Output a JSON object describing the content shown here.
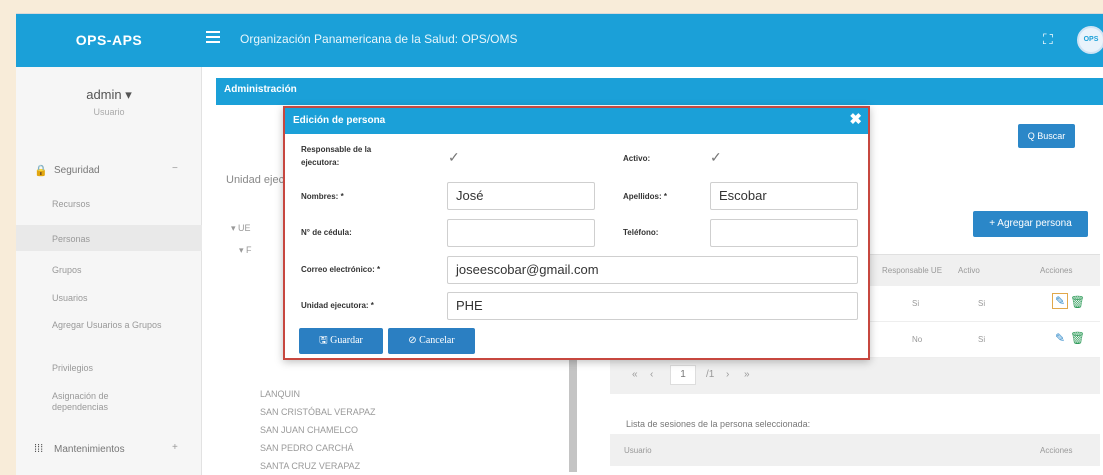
{
  "topbar": {
    "brand": "OPS-APS",
    "org_title": "Organización Panamericana de la Salud: OPS/OMS",
    "fullscreen_glyph": "⛶",
    "avatar_text": "OPS"
  },
  "sidebar": {
    "user_name": "admin ▾",
    "user_role": "Usuario",
    "seguridad": {
      "label": "Seguridad",
      "icon": "lock-icon",
      "glyph": "🔒",
      "toggle": "−"
    },
    "items": [
      {
        "label": "Recursos"
      },
      {
        "label": "Personas"
      },
      {
        "label": "Grupos"
      },
      {
        "label": "Usuarios"
      },
      {
        "label": "Agregar Usuarios a Grupos"
      },
      {
        "label": "Privilegios"
      },
      {
        "label": "Asignación de dependencias"
      }
    ],
    "mantenimientos": {
      "label": "Mantenimientos",
      "icon": "grid-icon",
      "glyph": "⁞⁞⁞",
      "toggle": "+"
    }
  },
  "main": {
    "panel_title": "Administración",
    "search_label": "Q Buscar",
    "unidad_label": "Unidad ejecutora:",
    "add_person_label": "+ Agregar persona",
    "tree_items": [
      "▾ UE",
      "▾ F",
      "LANQUIN",
      "SAN CRISTÓBAL VERAPAZ",
      "SAN JUAN CHAMELCO",
      "SAN PEDRO CARCHÁ",
      "SANTA CRUZ VERAPAZ"
    ],
    "grid_headers": {
      "responsable": "Responsable UE",
      "activo": "Activo",
      "acciones": "Acciones"
    },
    "grid_rows": [
      {
        "responsable": "Si",
        "activo": "Si",
        "edit_glyph": "✎",
        "delete_glyph": "🗑"
      },
      {
        "responsable": "No",
        "activo": "Si",
        "edit_glyph": "✎",
        "delete_glyph": "🗑"
      }
    ],
    "pager": {
      "first": "«",
      "prev": "‹",
      "page": "1",
      "total": "/1",
      "next": "›",
      "last": "»"
    },
    "sesiones_label": "Lista de sesiones de la persona seleccionada:",
    "sesiones_headers": {
      "usuario": "Usuario",
      "acciones": "Acciones"
    }
  },
  "modal": {
    "title": "Edición de persona",
    "close": "✖",
    "responsable_label": "Responsable de la ejecutora:",
    "responsable_checked": true,
    "activo_label": "Activo:",
    "activo_checked": true,
    "check_glyph": "✓",
    "nombres_label": "Nombres: *",
    "nombres_value": "José",
    "apellidos_label": "Apellidos: *",
    "apellidos_value": "Escobar",
    "cedula_label": "N° de cédula:",
    "cedula_value": "",
    "telefono_label": "Teléfono:",
    "telefono_value": "",
    "correo_label": "Correo electrónico: *",
    "correo_value": "joseescobar@gmail.com",
    "unidad_label": "Unidad ejecutora: *",
    "unidad_value": "PHE",
    "guardar_label": "🖫 Guardar",
    "cancelar_label": "⊘ Cancelar"
  }
}
